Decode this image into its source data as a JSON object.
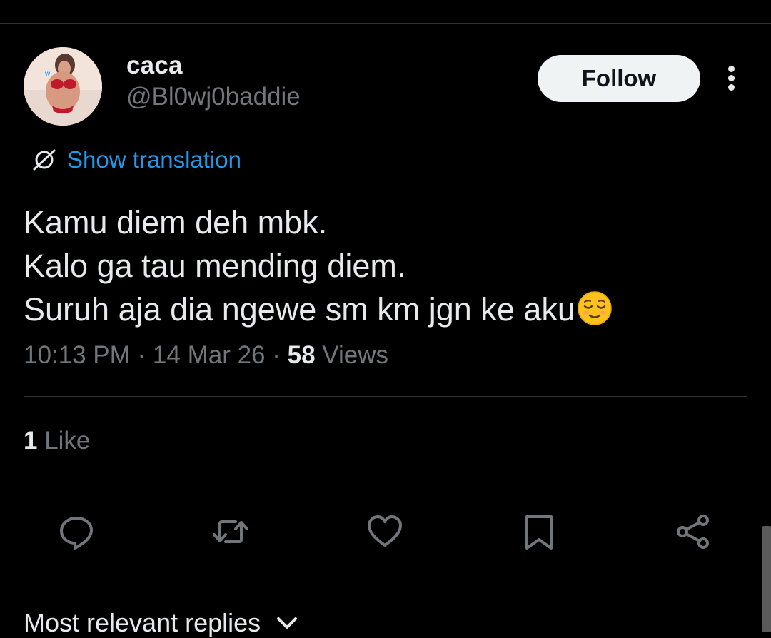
{
  "author": {
    "display_name": "caca",
    "handle": "@Bl0wj0baddie"
  },
  "follow_label": "Follow",
  "translate_label": "Show translation",
  "tweet": {
    "lines": [
      "Kamu diem deh mbk.",
      "Kalo ga tau mending diem.",
      "Suruh aja dia ngewe sm km jgn ke aku"
    ],
    "emoji": "relieved-face",
    "time": "10:13 PM",
    "sep1": " · ",
    "date": "14 Mar 26",
    "sep2": " · ",
    "views_count": "58",
    "views_label": " Views"
  },
  "likes": {
    "count": "1",
    "label": " Like"
  },
  "actions": [
    "reply-icon",
    "retweet-icon",
    "like-icon",
    "bookmark-icon",
    "share-icon"
  ],
  "replies_header": "Most relevant replies",
  "colors": {
    "background": "#000000",
    "text": "#e7e9ea",
    "secondary": "#71767b",
    "link": "#1d9bf0",
    "divider": "#2f3336",
    "follow_bg": "#eff3f4"
  }
}
